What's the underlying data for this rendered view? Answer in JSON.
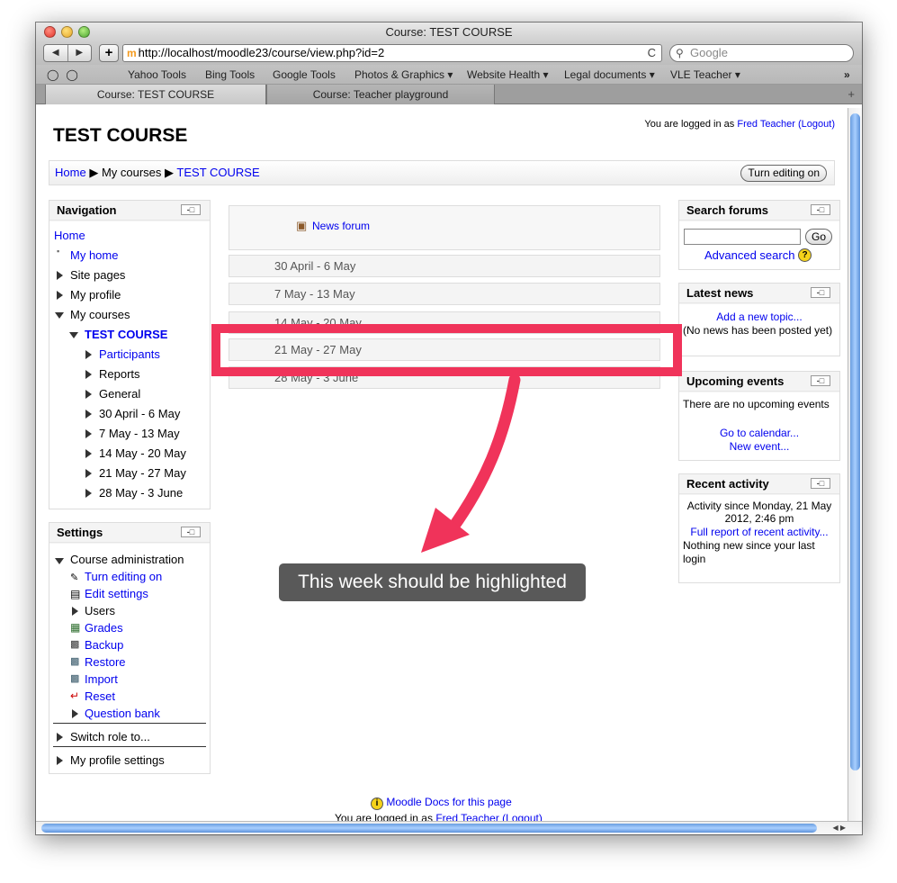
{
  "window": {
    "title": "Course: TEST COURSE"
  },
  "browser": {
    "back": "◀",
    "forward": "▶",
    "add": "+",
    "url": "http://localhost/moodle23/course/view.php?id=2",
    "reload": "C",
    "search_placeholder": "Google",
    "bookmarks": [
      "Yahoo Tools",
      "Bing Tools",
      "Google Tools",
      "Photos & Graphics ▾",
      "Website Health ▾",
      "Legal documents ▾",
      "VLE Teacher ▾"
    ],
    "bookmarks_more": "»",
    "tabs": [
      "Course: TEST COURSE",
      "Course: Teacher playground"
    ]
  },
  "header": {
    "login_prefix": "You are logged in as",
    "user": "Fred Teacher",
    "logout": "(Logout)",
    "course_title": "TEST COURSE"
  },
  "breadcrumb": {
    "home": "Home",
    "my_courses": "My courses",
    "course": "TEST COURSE",
    "sep": "▶"
  },
  "edit_button": "Turn editing on",
  "navigation": {
    "title": "Navigation",
    "home": "Home",
    "my_home": "My home",
    "site_pages": "Site pages",
    "my_profile": "My profile",
    "my_courses": "My courses",
    "test_course": "TEST COURSE",
    "participants": "Participants",
    "reports": "Reports",
    "general": "General",
    "weeks": [
      "30 April - 6 May",
      "7 May - 13 May",
      "14 May - 20 May",
      "21 May - 27 May",
      "28 May - 3 June"
    ]
  },
  "settings": {
    "title": "Settings",
    "course_admin": "Course administration",
    "turn_editing_on": "Turn editing on",
    "edit_settings": "Edit settings",
    "users": "Users",
    "grades": "Grades",
    "backup": "Backup",
    "restore": "Restore",
    "import": "Import",
    "reset": "Reset",
    "question_bank": "Question bank",
    "switch_role": "Switch role to...",
    "my_profile_settings": "My profile settings"
  },
  "main": {
    "news_forum": "News forum",
    "weeks": [
      "30 April - 6 May",
      "7 May - 13 May",
      "14 May - 20 May",
      "21 May - 27 May",
      "28 May - 3 June"
    ]
  },
  "search_forums": {
    "title": "Search forums",
    "go": "Go",
    "advanced": "Advanced search"
  },
  "latest_news": {
    "title": "Latest news",
    "add": "Add a new topic...",
    "none": "(No news has been posted yet)"
  },
  "upcoming": {
    "title": "Upcoming events",
    "none": "There are no upcoming events",
    "calendar": "Go to calendar...",
    "new_event": "New event..."
  },
  "recent": {
    "title": "Recent activity",
    "since": "Activity since Monday, 21 May 2012, 2:46 pm",
    "full": "Full report of recent activity...",
    "nothing": "Nothing new since your last login"
  },
  "footer": {
    "docs": "Moodle Docs for this page",
    "login_prefix": "You are logged in as",
    "user": "Fred Teacher",
    "logout": "(Logout)"
  },
  "annotation": {
    "text": "This week should be highlighted",
    "color": "#f0335a"
  }
}
